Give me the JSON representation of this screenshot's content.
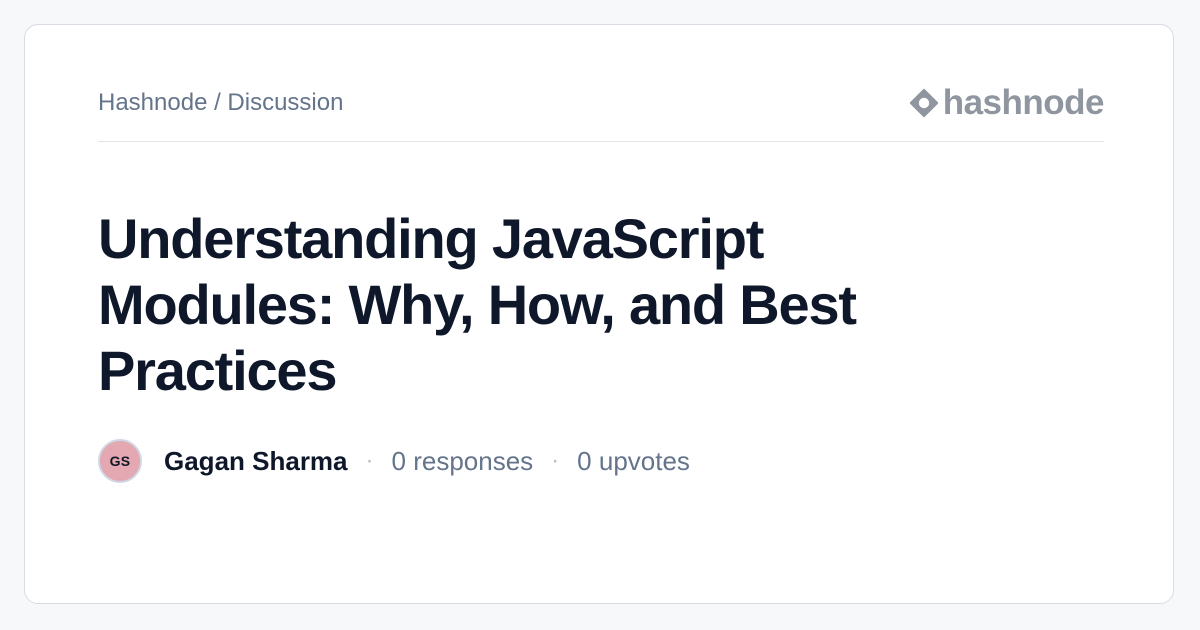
{
  "header": {
    "breadcrumb": "Hashnode / Discussion",
    "logo_text": "hashnode",
    "logo_icon": "hashnode-logo-icon"
  },
  "post": {
    "title": "Understanding JavaScript Modules: Why, How, and Best Practices",
    "author": {
      "initials": "GS",
      "name": "Gagan Sharma"
    },
    "responses": "0 responses",
    "upvotes": "0 upvotes",
    "separator": "·"
  },
  "colors": {
    "background": "#f7f8fa",
    "card": "#ffffff",
    "title": "#0f172a",
    "muted": "#64748b",
    "logo": "#8f969f",
    "avatar": "#e3a8b2"
  }
}
